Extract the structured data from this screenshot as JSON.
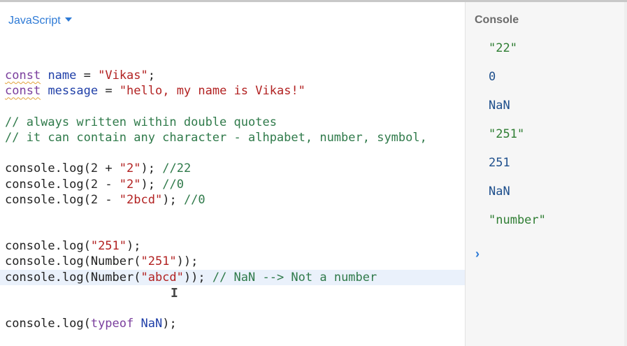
{
  "editor": {
    "language": "JavaScript",
    "lines": [
      [],
      [
        {
          "t": "const",
          "c": "kw squig"
        },
        {
          "t": " "
        },
        {
          "t": "name",
          "c": "var"
        },
        {
          "t": " = "
        },
        {
          "t": "\"Vikas\"",
          "c": "str"
        },
        {
          "t": ";"
        }
      ],
      [
        {
          "t": "const",
          "c": "kw squig"
        },
        {
          "t": " "
        },
        {
          "t": "message",
          "c": "var"
        },
        {
          "t": " = "
        },
        {
          "t": "\"hello, my name is Vikas!\"",
          "c": "str"
        }
      ],
      [],
      [
        {
          "t": "// always written within double quotes",
          "c": "com"
        }
      ],
      [
        {
          "t": "// it can contain any character - alhpabet, number, symbol,",
          "c": "com"
        }
      ],
      [],
      [
        {
          "t": "console.log("
        },
        {
          "t": "2",
          "c": "num"
        },
        {
          "t": " + "
        },
        {
          "t": "\"2\"",
          "c": "str"
        },
        {
          "t": "); "
        },
        {
          "t": "//22",
          "c": "com"
        }
      ],
      [
        {
          "t": "console.log("
        },
        {
          "t": "2",
          "c": "num"
        },
        {
          "t": " - "
        },
        {
          "t": "\"2\"",
          "c": "str"
        },
        {
          "t": "); "
        },
        {
          "t": "//0",
          "c": "com"
        }
      ],
      [
        {
          "t": "console.log("
        },
        {
          "t": "2",
          "c": "num"
        },
        {
          "t": " - "
        },
        {
          "t": "\"2bcd\"",
          "c": "str"
        },
        {
          "t": "); "
        },
        {
          "t": "//0",
          "c": "com"
        }
      ],
      [],
      [],
      [
        {
          "t": "console.log("
        },
        {
          "t": "\"251\"",
          "c": "str"
        },
        {
          "t": ");"
        }
      ],
      [
        {
          "t": "console.log(Number("
        },
        {
          "t": "\"251\"",
          "c": "str"
        },
        {
          "t": "));"
        }
      ],
      [
        {
          "t": "console.log(Number("
        },
        {
          "t": "\"abcd\"",
          "c": "str"
        },
        {
          "t": ")); "
        },
        {
          "t": "// NaN --> Not a number",
          "c": "com"
        }
      ],
      [],
      [],
      [
        {
          "t": "console.log("
        },
        {
          "t": "typeof",
          "c": "kw"
        },
        {
          "t": " "
        },
        {
          "t": "NaN",
          "c": "var"
        },
        {
          "t": ");"
        }
      ]
    ],
    "active_line": 14
  },
  "console": {
    "title": "Console",
    "outputs": [
      {
        "text": "\"22\"",
        "kind": "str"
      },
      {
        "text": "0",
        "kind": "val"
      },
      {
        "text": "NaN",
        "kind": "val"
      },
      {
        "text": "\"251\"",
        "kind": "str"
      },
      {
        "text": "251",
        "kind": "val"
      },
      {
        "text": "NaN",
        "kind": "val"
      },
      {
        "text": "\"number\"",
        "kind": "str"
      }
    ],
    "prompt": "›"
  },
  "colors": {
    "accent": "#2d7ad6",
    "keyword": "#7a3e9d",
    "variable": "#1f3fa8",
    "string": "#b22222",
    "comment": "#2f7a4a",
    "console_string": "#2e7d32",
    "console_value": "#1e4f8c"
  },
  "icons": {
    "language_dropdown": "chevron-down-icon",
    "console_prompt": "chevron-right-icon",
    "text_cursor": "i-beam-cursor-icon"
  }
}
